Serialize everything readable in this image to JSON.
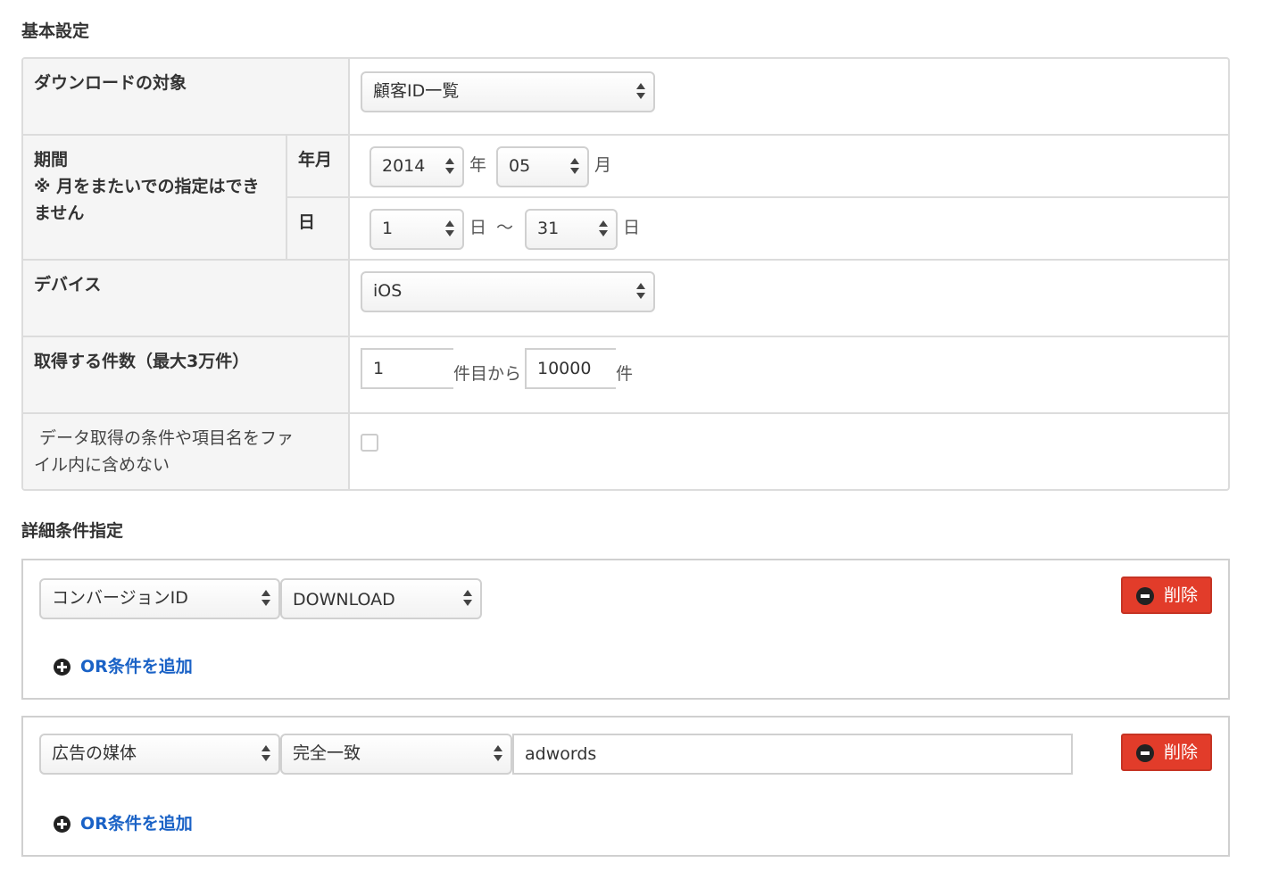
{
  "basic": {
    "heading": "基本設定",
    "target": {
      "label": "ダウンロードの対象",
      "value": "顧客ID一覧"
    },
    "period": {
      "label": "期間",
      "note_line1": "※ 月をまたいでの指定はでき",
      "note_line2": "ません",
      "year_month_label": "年月",
      "year": "2014",
      "year_unit": "年",
      "month": "05",
      "month_unit": "月",
      "day_label": "日",
      "day_from": "1",
      "day_from_unit": "日",
      "tilde": "〜",
      "day_to": "31",
      "day_to_unit": "日"
    },
    "device": {
      "label": "デバイス",
      "value": "iOS"
    },
    "count": {
      "label": "取得する件数（最大3万件）",
      "from": "1",
      "from_unit": "件目から",
      "to": "10000",
      "to_unit": "件"
    },
    "exclude": {
      "label_line1": " データ取得の条件や項目名をファ",
      "label_line2": "イル内に含めない",
      "checked": false
    }
  },
  "detail": {
    "heading": "詳細条件指定",
    "conditions": [
      {
        "field": "コンバージョンID",
        "operator": "DOWNLOAD",
        "value": "",
        "delete_label": "削除",
        "add_or_label": "OR条件を追加"
      },
      {
        "field": "広告の媒体",
        "operator": "完全一致",
        "value": "adwords",
        "delete_label": "削除",
        "add_or_label": "OR条件を追加"
      }
    ]
  },
  "colors": {
    "delete_button": "#e23c2a",
    "link": "#1a62c6",
    "label_bg": "#f5f5f5",
    "border": "#dcdcdc"
  }
}
